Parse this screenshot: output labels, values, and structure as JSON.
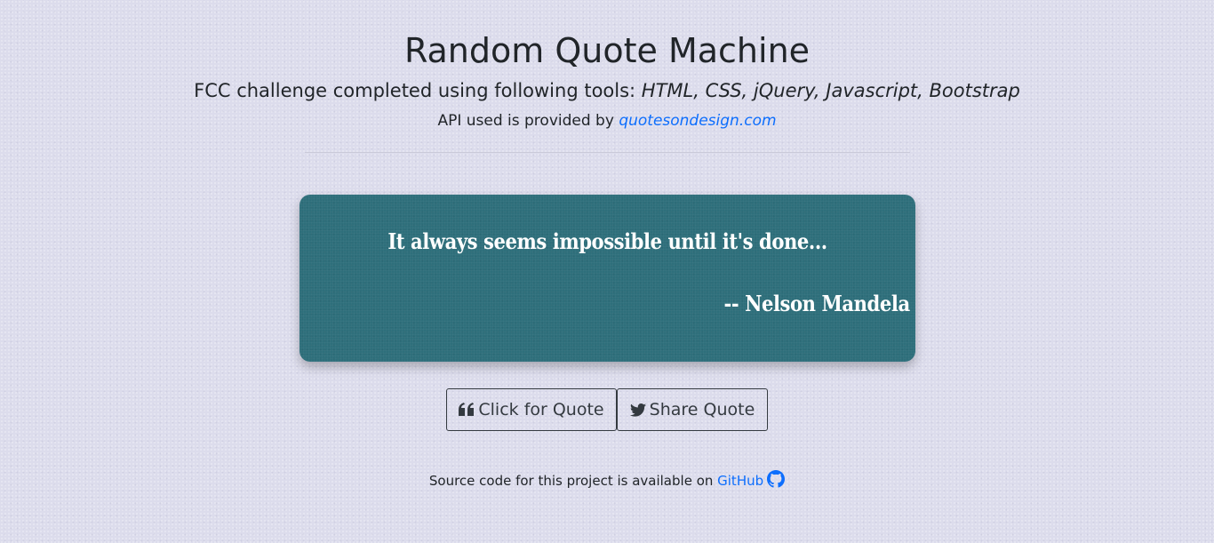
{
  "header": {
    "title": "Random Quote Machine",
    "subtitle_prefix": "FCC challenge completed using following tools: ",
    "subtitle_tools": "HTML, CSS, jQuery, Javascript, Bootstrap",
    "api_prefix": "API used is provided by ",
    "api_link": "quotesondesign.com"
  },
  "quote": {
    "text": "It always seems impossible until it's done...",
    "author": "-- Nelson Mandela"
  },
  "buttons": {
    "new_quote_label": "Click for Quote",
    "new_quote_icon": "quote-left-icon",
    "share_label": "Share Quote",
    "share_icon": "twitter-icon"
  },
  "footer": {
    "text": "Source code for this project is available on ",
    "link": "GitHub",
    "link_icon": "github-icon"
  },
  "colors": {
    "background": "#dcdcec",
    "card": "#2e6f7b",
    "link": "#0d6efd",
    "button_border": "#343a40"
  }
}
